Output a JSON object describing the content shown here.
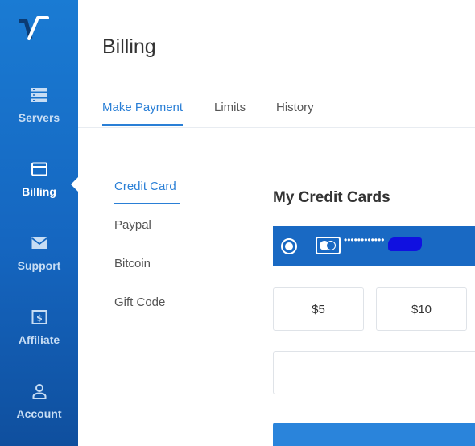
{
  "sidebar": {
    "items": [
      {
        "label": "Servers",
        "icon": "servers-icon"
      },
      {
        "label": "Billing",
        "icon": "billing-card-icon"
      },
      {
        "label": "Support",
        "icon": "envelope-icon"
      },
      {
        "label": "Affiliate",
        "icon": "dollar-icon"
      },
      {
        "label": "Account",
        "icon": "user-icon"
      }
    ],
    "active": "Billing"
  },
  "header": {
    "title": "Billing"
  },
  "tabs": [
    {
      "label": "Make Payment"
    },
    {
      "label": "Limits"
    },
    {
      "label": "History"
    }
  ],
  "payment_methods": [
    {
      "label": "Credit Card"
    },
    {
      "label": "Paypal"
    },
    {
      "label": "Bitcoin"
    },
    {
      "label": "Gift Code"
    }
  ],
  "credit_cards": {
    "title": "My Credit Cards",
    "card_number_masked": "••••••••••••"
  },
  "amounts": [
    {
      "label": "$5"
    },
    {
      "label": "$10"
    }
  ],
  "colors": {
    "accent": "#2a7fd6",
    "sidebar": "#1566c0",
    "card_row": "#1969c3"
  }
}
